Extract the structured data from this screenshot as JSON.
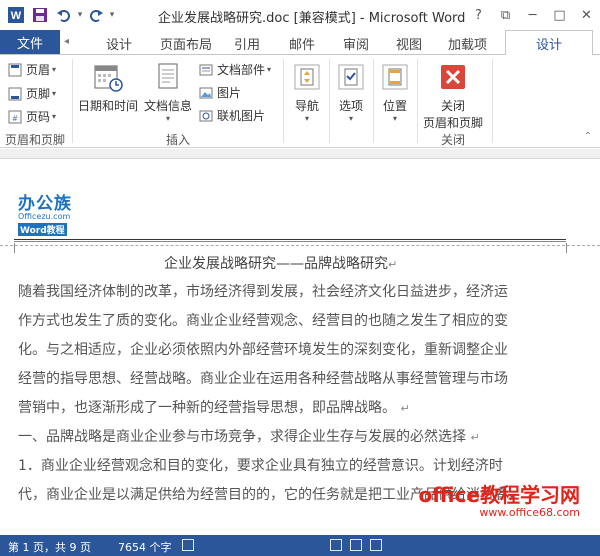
{
  "window": {
    "title": "企业发展战略研究.doc [兼容模式] - Microsoft Word",
    "help": "?",
    "restore": "⧉",
    "minimize": "─",
    "maximize": "□",
    "close": "✕"
  },
  "tabs": {
    "file": "文件",
    "design_left": "设计",
    "page_layout": "页面布局",
    "references": "引用",
    "mailings": "邮件",
    "review": "审阅",
    "view": "视图",
    "addins": "加载项",
    "design_active": "设计"
  },
  "ribbon": {
    "header": "页眉",
    "footer": "页脚",
    "page_number": "页码",
    "group_header_footer": "页眉和页脚",
    "date_time": "日期和时间",
    "doc_info": "文档信息",
    "quick_parts": "文档部件",
    "pictures": "图片",
    "online_pictures": "联机图片",
    "group_insert": "插入",
    "navigation": "导航",
    "options": "选项",
    "position": "位置",
    "close_line1": "关闭",
    "close_line2": "页眉和页脚",
    "group_close": "关闭"
  },
  "document": {
    "logo_main": "办公族",
    "logo_url": "Officezu.com",
    "logo_sub": "Word教程",
    "title": "企业发展战略研究——品牌战略研究",
    "lines": [
      "随着我国经济体制的改革，市场经济得到发展，社会经济文化日益进步，经济运",
      "作方式也发生了质的变化。商业企业经营观念、经营目的也随之发生了相应的变",
      "化。与之相适应，企业必须依照内外部经营环境发生的深刻变化，重新调整企业",
      "经营的指导思想、经营战略。商业企业在运用各种经营战略从事经营管理与市场",
      "营销中，也逐渐形成了一种新的经营指导思想，即品牌战略。",
      "一、品牌战略是商业企业参与市场竞争，求得企业生存与发展的必然选择",
      "1．商业企业经营观念和目的变化，要求企业具有独立的经营意识。计划经济时",
      "代，商业企业是以满足供给为经营目的的，它的任务就是把工业产品供给消费者，"
    ]
  },
  "watermark": {
    "line1": "office教程学习网",
    "line2": "www.office68.com"
  },
  "status": {
    "page": "第 1 页，共 9 页",
    "words": "7654 个字"
  },
  "colors": {
    "accent": "#2b579a",
    "watermark": "#e2231a",
    "close_button": "#d9473b"
  }
}
